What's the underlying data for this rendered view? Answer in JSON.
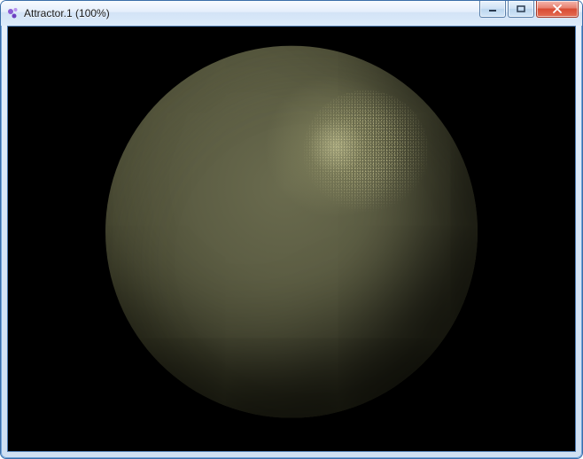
{
  "window": {
    "title": "Attractor.1 (100%)",
    "icon_name": "app-icon"
  },
  "controls": {
    "minimize_name": "minimize-icon",
    "maximize_name": "maximize-icon",
    "close_name": "close-icon"
  },
  "viewport": {
    "object": "sphere",
    "background_color": "#000000",
    "sphere_base_color": "#5d5e44",
    "sphere_highlight_color": "#d2d2a0"
  }
}
